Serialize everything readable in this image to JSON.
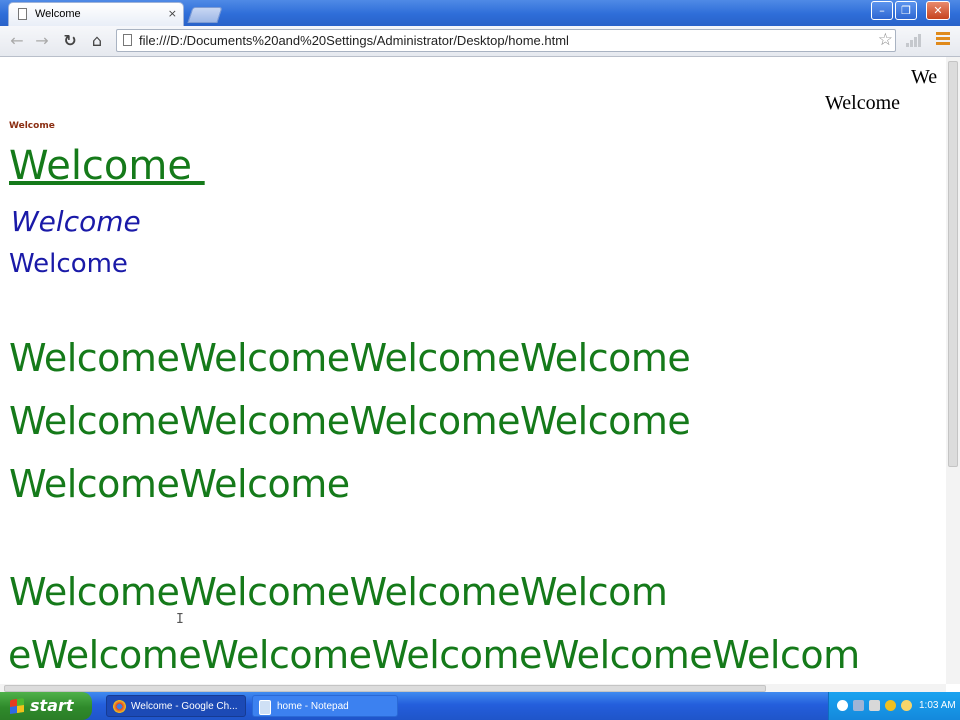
{
  "browser": {
    "tab": {
      "title": "Welcome",
      "close_glyph": "×"
    },
    "window_buttons": {
      "minimize": "–",
      "maximize": "❐",
      "close": "✕"
    },
    "nav": {
      "back": "←",
      "forward": "→",
      "reload": "↻",
      "home": "⌂"
    },
    "address_bar": {
      "url": "file:///D:/Documents%20and%20Settings/Administrator/Desktop/home.html",
      "star": "☆"
    }
  },
  "page": {
    "top_right_clipped": "We",
    "top_right": "Welcome",
    "small_heading": "Welcome",
    "large_underlined": "Welcome ",
    "italic": "Welcome",
    "plain": "Welcome",
    "green_block_1": [
      "WelcomeWelcomeWelcomeWelcome",
      "WelcomeWelcomeWelcomeWelcome",
      "WelcomeWelcome"
    ],
    "green_block_2": [
      "WelcomeWelcomeWelcomeWelcom",
      "eWelcomeWelcomeWelcomeWelcomeWelcom"
    ],
    "text_cursor": "I"
  },
  "taskbar": {
    "start_label": "start",
    "items": [
      {
        "label": "Welcome - Google Ch..."
      },
      {
        "label": "home - Notepad"
      }
    ],
    "clock": "1:03 AM"
  },
  "colors": {
    "green_text": "#157a1a",
    "blue_text": "#1a1aa8",
    "brown_text": "#8b2e12",
    "titlebar": "#2e6dd8",
    "taskbar": "#245edc",
    "start_button": "#2f8a2b"
  }
}
